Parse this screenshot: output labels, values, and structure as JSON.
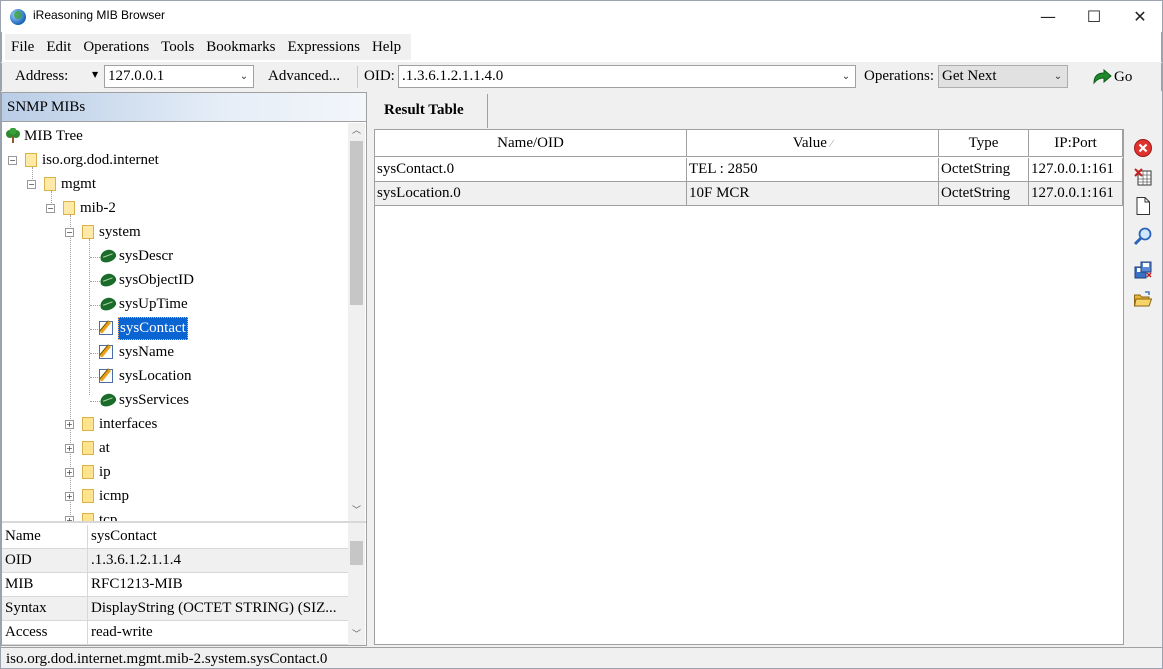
{
  "window": {
    "title": "iReasoning MIB Browser",
    "minimize": "—",
    "maximize": "☐",
    "close": "✕"
  },
  "menu": [
    "File",
    "Edit",
    "Operations",
    "Tools",
    "Bookmarks",
    "Expressions",
    "Help"
  ],
  "toolbar": {
    "address_label": "Address:",
    "address_value": "127.0.0.1",
    "advanced_label": "Advanced...",
    "oid_label": "OID:",
    "oid_value": ".1.3.6.1.2.1.1.4.0",
    "operations_label": "Operations:",
    "operations_value": "Get Next",
    "go_label": "Go"
  },
  "left_panel": {
    "header": "SNMP MIBs",
    "tree": {
      "root": "MIB Tree",
      "internet": "iso.org.dod.internet",
      "mgmt": "mgmt",
      "mib2": "mib-2",
      "system": "system",
      "system_children": [
        {
          "label": "sysDescr",
          "icon": "leaf-icon"
        },
        {
          "label": "sysObjectID",
          "icon": "leaf-icon"
        },
        {
          "label": "sysUpTime",
          "icon": "leaf-icon"
        },
        {
          "label": "sysContact",
          "icon": "writable-icon",
          "selected": true
        },
        {
          "label": "sysName",
          "icon": "writable-icon"
        },
        {
          "label": "sysLocation",
          "icon": "writable-icon"
        },
        {
          "label": "sysServices",
          "icon": "leaf-icon"
        }
      ],
      "siblings": [
        "interfaces",
        "at",
        "ip",
        "icmp",
        "tcp"
      ]
    },
    "properties": [
      {
        "key": "Name",
        "value": "sysContact"
      },
      {
        "key": "OID",
        "value": ".1.3.6.1.2.1.1.4"
      },
      {
        "key": "MIB",
        "value": "RFC1213-MIB"
      },
      {
        "key": "Syntax",
        "value": "DisplayString (OCTET STRING) (SIZ..."
      },
      {
        "key": "Access",
        "value": "read-write"
      }
    ]
  },
  "result": {
    "tab": "Result Table",
    "columns": [
      "Name/OID",
      "Value",
      "Type",
      "IP:Port"
    ],
    "sort_indicator": "⁄",
    "rows": [
      [
        "sysContact.0",
        "TEL : 2850",
        "OctetString",
        "127.0.0.1:161"
      ],
      [
        "sysLocation.0",
        "10F MCR",
        "OctetString",
        "127.0.0.1:161"
      ]
    ]
  },
  "side_tools": [
    "delete-icon",
    "clear-table-icon",
    "new-document-icon",
    "find-icon",
    "save-icon",
    "open-folder-icon"
  ],
  "status": "iso.org.dod.internet.mgmt.mib-2.system.sysContact.0"
}
